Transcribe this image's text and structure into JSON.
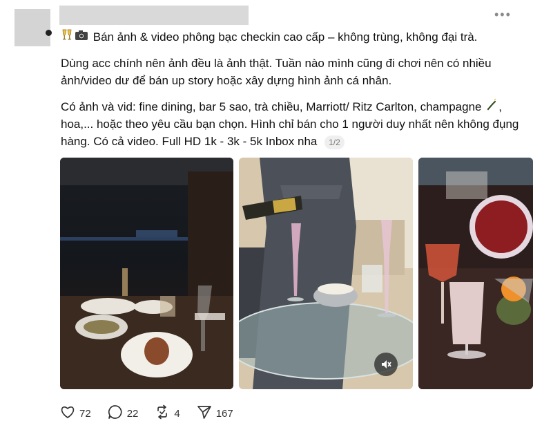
{
  "post": {
    "line1_text": "Bán ảnh & video phông bạc checkin cao cấp – không trùng, không đại trà.",
    "line1_icons": [
      "champagne-glasses-icon",
      "camera-icon"
    ],
    "line2_text": "Dùng acc chính nên ảnh đều là ảnh thật. Tuần nào mình cũng đi chơi nên có nhiều ảnh/video dư để bán up story hoặc xây dựng hình ảnh cá nhân.",
    "line3_text_a": "Có ảnh và vid: fine dining, bar 5 sao, trà chiều, Marriott/ Ritz Carlton, champagne",
    "line3_icon": "champagne-bottle-icon",
    "line3_text_b": ", hoa,... hoặc theo yêu cầu bạn chọn. Hình chỉ bán cho 1 người duy nhất nên không đụng hàng. Có cả video. Full HD 1k - 3k - 5k Inbox nha",
    "media_counter": "1/2"
  },
  "actions": {
    "likes": "72",
    "replies": "22",
    "reposts": "4",
    "shares": "167"
  },
  "icons": [
    "more-icon",
    "heart-icon",
    "reply-icon",
    "repost-icon",
    "share-icon",
    "mute-icon"
  ]
}
